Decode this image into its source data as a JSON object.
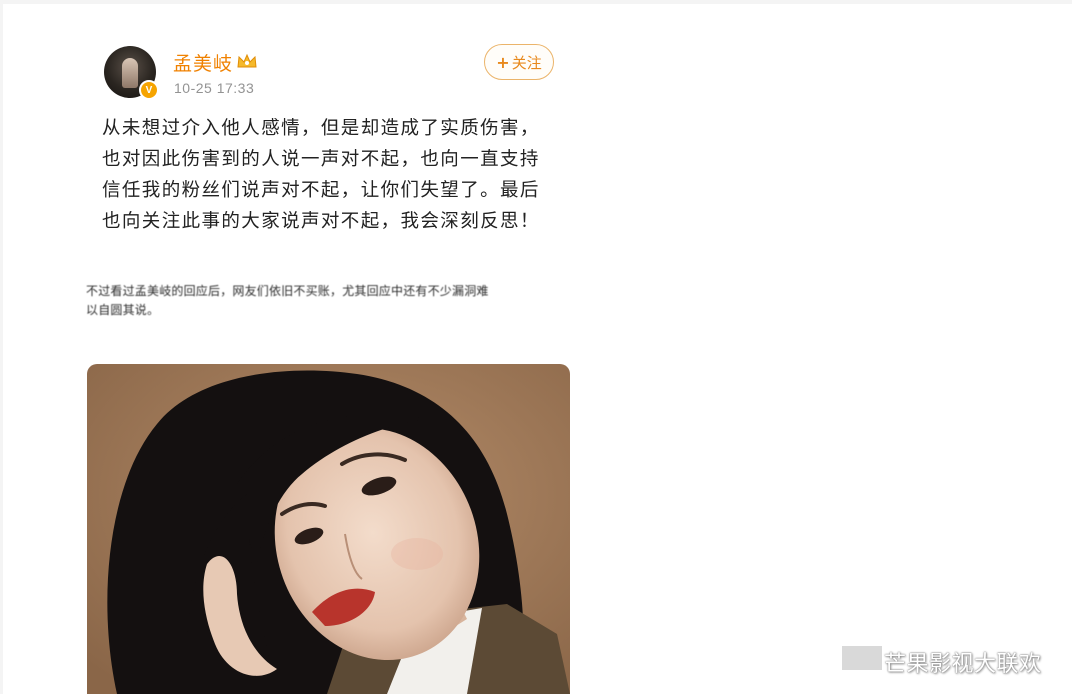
{
  "post": {
    "username": "孟美岐",
    "time": "10-25 17:33",
    "verify_mark": "V",
    "follow_label": "关注",
    "follow_plus": "+",
    "content_lines": [
      "从未想过介入他人感情，但是却造成了实质伤害，",
      "也对因此伤害到的人说一声对不起，也向一直支持",
      "信任我的粉丝们说声对不起，让你们失望了。最后",
      "也向关注此事的大家说声对不起，我会深刻反思！"
    ]
  },
  "caption": {
    "lines": [
      "不过看过孟美岐的回应后，网友们依旧不买账，尤其回应中还有不少漏洞难",
      "以自圆其说。"
    ]
  },
  "photo": {
    "background": "#a47d5b"
  },
  "watermark": {
    "text": "芒果影视大联欢"
  },
  "icons": [
    "avatar",
    "verified-badge-icon",
    "crown-icon",
    "plus-icon"
  ],
  "colors": {
    "username": "#f08100",
    "follow_border": "#ebb46a",
    "follow_text": "#e8891d",
    "verify": "#f6a400",
    "time": "#939393"
  }
}
